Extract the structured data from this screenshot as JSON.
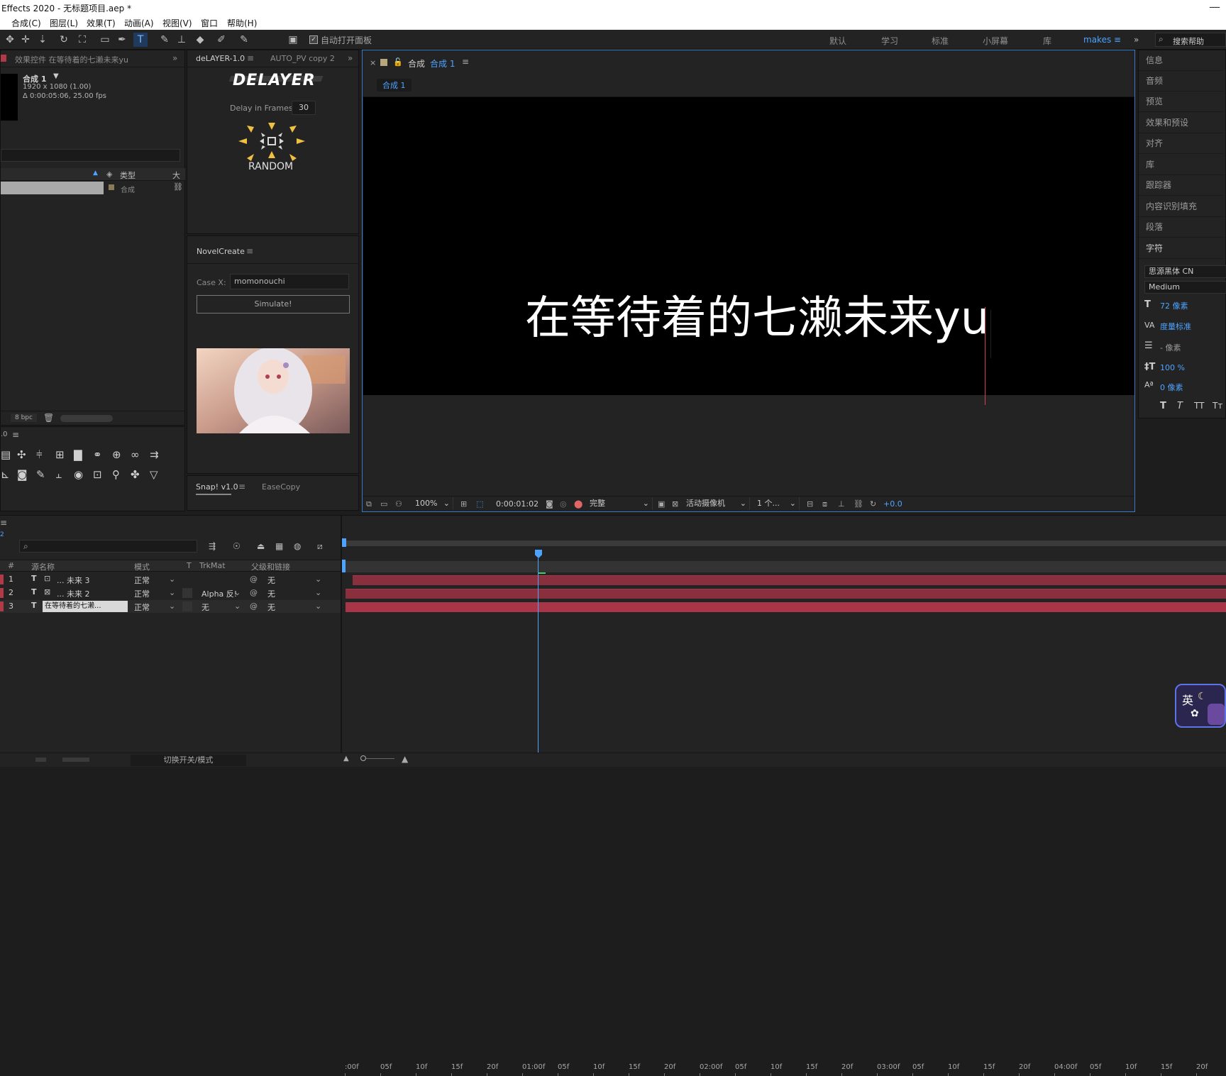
{
  "title": "Effects 2020 - 无标题项目.aep *",
  "menu": [
    "合成(C)",
    "图层(L)",
    "效果(T)",
    "动画(A)",
    "视图(V)",
    "窗口",
    "帮助(H)"
  ],
  "toolbar": {
    "auto_open": "自动打开面板",
    "workspaces": [
      "默认",
      "学习",
      "标准",
      "小屏幕",
      "库"
    ],
    "active_ws": "makes",
    "search": "搜索帮助"
  },
  "effects_tab": "效果控件 在等待着的七濑未来yu",
  "project": {
    "comp_name": "合成 1",
    "res": "1920 x 1080 (1.00)",
    "dur": "Δ 0:00:05:06, 25.00 fps",
    "col_type": "类型",
    "col_size": "大",
    "item_type": "合成",
    "bpc": "8 bpc"
  },
  "delayer": {
    "tab": "deLAYER-1.0",
    "tab2": "AUTO_PV copy 2",
    "logo": "DELAYER",
    "label": "Delay in Frames:",
    "value": "30",
    "random": "RANDOM"
  },
  "novel": {
    "tab": "NovelCreate",
    "case_label": "Case X:",
    "case_value": "momonouchi",
    "simulate": "Simulate!"
  },
  "snap": {
    "tab": "Snap! v1.0",
    "tab2": "EaseCopy"
  },
  "comp": {
    "tab_prefix": "合成",
    "tab_name": "合成 1",
    "breadcrumb": "合成 1",
    "text": "在等待着的七濑未来yu",
    "zoom": "100%",
    "time": "0:00:01:02",
    "quality": "完整",
    "camera": "活动摄像机",
    "views": "1 个...",
    "exposure": "+0.0"
  },
  "right": {
    "items": [
      "信息",
      "音频",
      "预览",
      "效果和预设",
      "对齐",
      "库",
      "跟踪器",
      "内容识别填充",
      "段落",
      "字符"
    ],
    "font": "思源黑体 CN",
    "style": "Medium",
    "size": "72 像素",
    "tracking": "度量标准",
    "leading": "- 像素",
    "scale": "100 %",
    "baseline": "0 像素"
  },
  "timeline": {
    "cols": {
      "num": "#",
      "name": "源名称",
      "mode": "模式",
      "t": "T",
      "trk": "TrkMat",
      "parent": "父级和链接"
    },
    "toggle": "切换开关/模式",
    "ruler": [
      ":00f",
      "05f",
      "10f",
      "15f",
      "20f",
      "01:00f",
      "05f",
      "10f",
      "15f",
      "20f",
      "02:00f",
      "05f",
      "10f",
      "15f",
      "20f",
      "03:00f",
      "05f",
      "10f",
      "15f",
      "20f",
      "04:00f",
      "05f",
      "10f",
      "15f",
      "20f"
    ],
    "layers": [
      {
        "num": "1",
        "name": "... 未来 3",
        "mode": "正常",
        "trk": "",
        "parent": "无"
      },
      {
        "num": "2",
        "name": "... 未来 2",
        "mode": "正常",
        "trk": "Alpha 反!",
        "parent": "无"
      },
      {
        "num": "3",
        "name": "在等待着的七濑...",
        "mode": "正常",
        "trk": "无",
        "parent": "无"
      }
    ]
  },
  "ime": {
    "lang": "英"
  }
}
